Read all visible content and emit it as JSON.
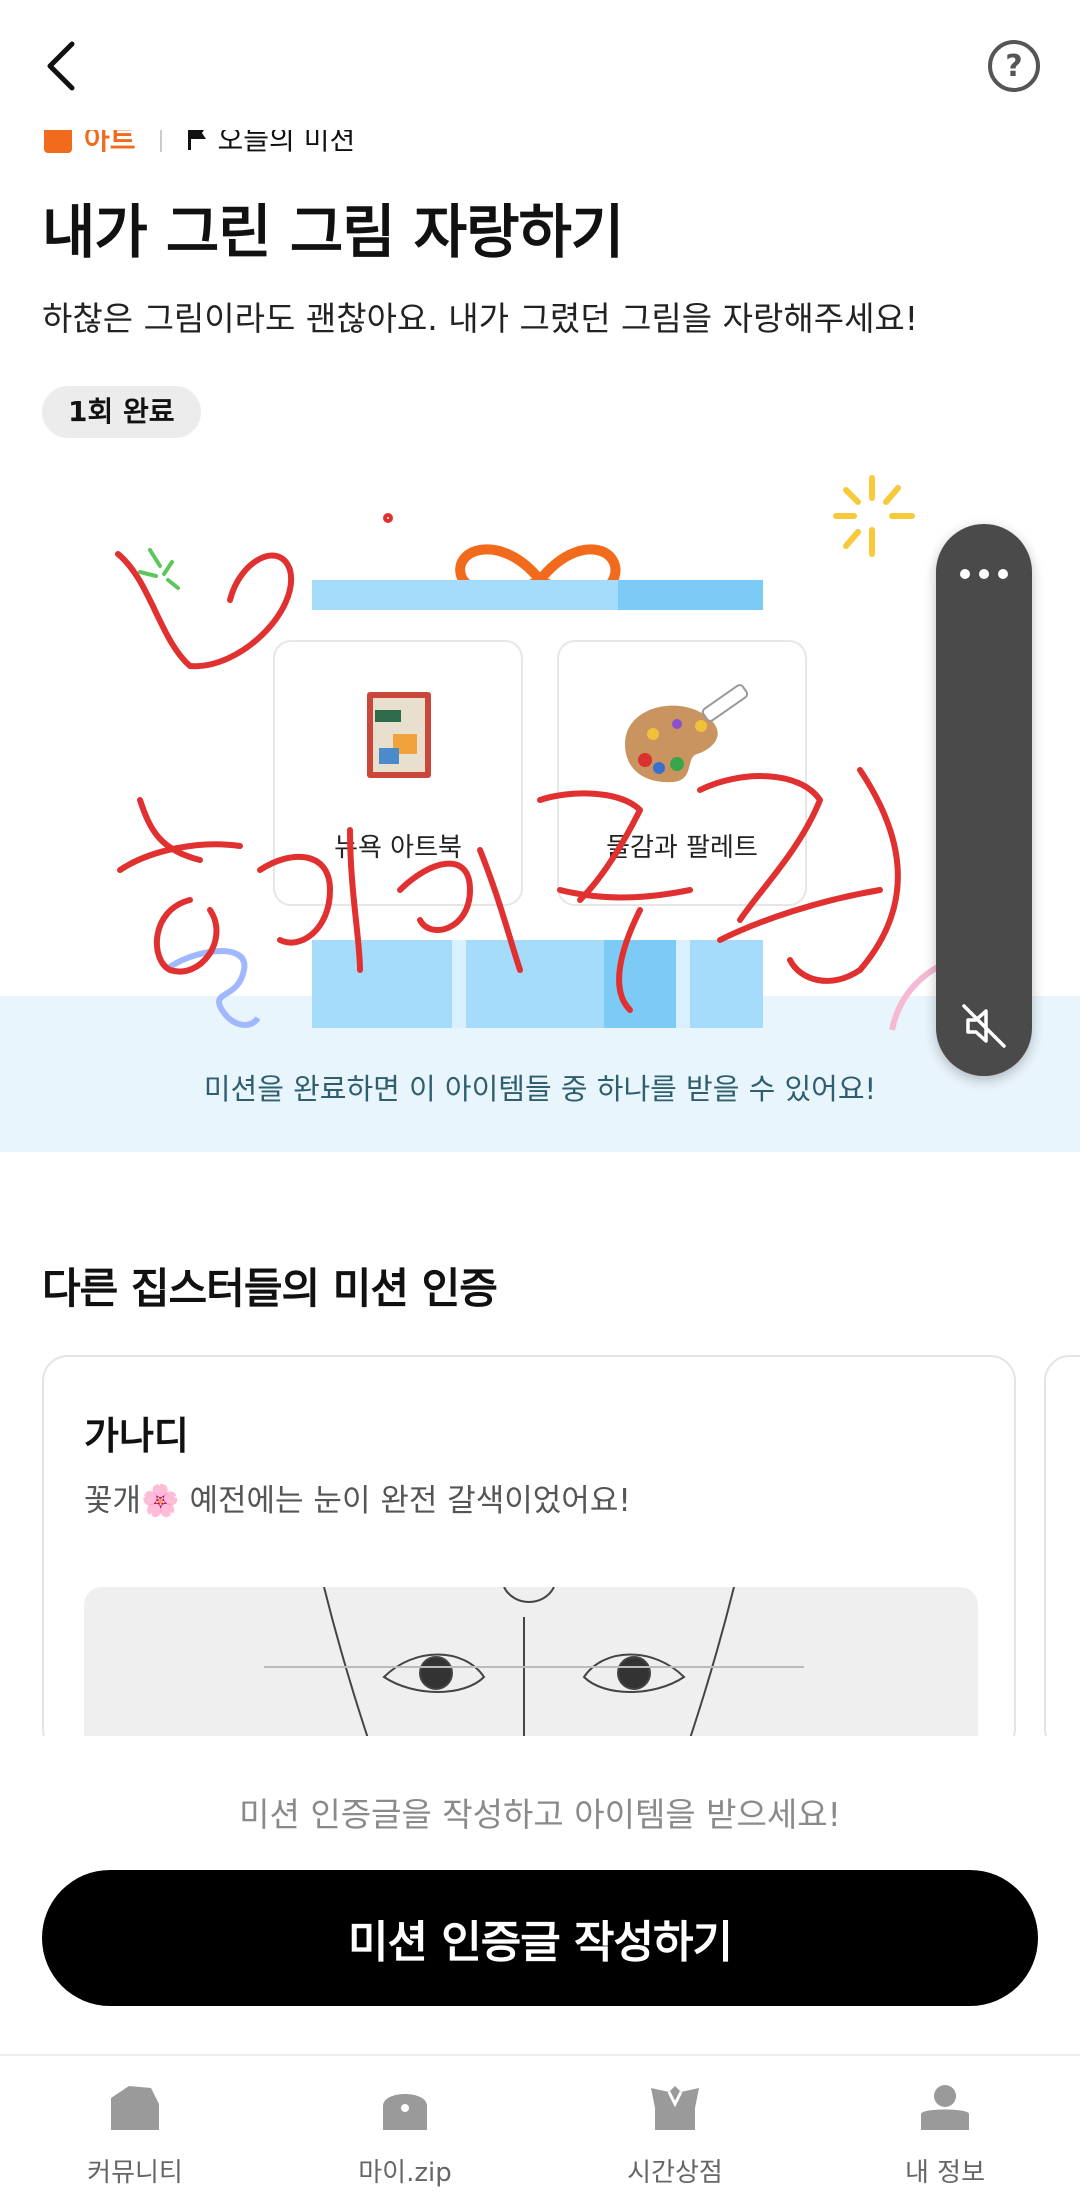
{
  "header": {
    "back_label": "back",
    "help_label": "?"
  },
  "category": {
    "tag": "아트",
    "mission_label": "오늘의 미션"
  },
  "mission": {
    "title": "내가 그린 그림 자랑하기",
    "description": "하찮은 그림이라도 괜찮아요. 내가 그렸던 그림을 자랑해주세요!",
    "badge": "1회 완료"
  },
  "reward": {
    "items": [
      {
        "label": "뉴욕 아트북",
        "icon": "artbook-icon"
      },
      {
        "label": "물감과 팔레트",
        "icon": "palette-icon"
      }
    ],
    "notice": "미션을 완료하면 이 아이템들 중 하나를 받을 수 있어요!"
  },
  "overlay": {
    "handwriting": "해피추석",
    "menu_icon": "more-icon",
    "sound_icon": "mute-icon"
  },
  "others": {
    "section_title": "다른 집스터들의 미션 인증",
    "posts": [
      {
        "author": "가나디",
        "text": "꽃개🌸 예전에는 눈이 완전 갈색이었어요!"
      }
    ]
  },
  "cta": {
    "hint": "미션 인증글을 작성하고 아이템을 받으세요!",
    "button": "미션 인증글 작성하기"
  },
  "nav": {
    "items": [
      {
        "label": "커뮤니티",
        "icon": "community-icon"
      },
      {
        "label": "마이.zip",
        "icon": "myzip-icon"
      },
      {
        "label": "시간상점",
        "icon": "shop-icon"
      },
      {
        "label": "내 정보",
        "icon": "profile-icon"
      }
    ]
  },
  "colors": {
    "accent": "#f26b1d",
    "gift": "#a6dcfb",
    "ink": "#e03030",
    "button": "#000000"
  }
}
